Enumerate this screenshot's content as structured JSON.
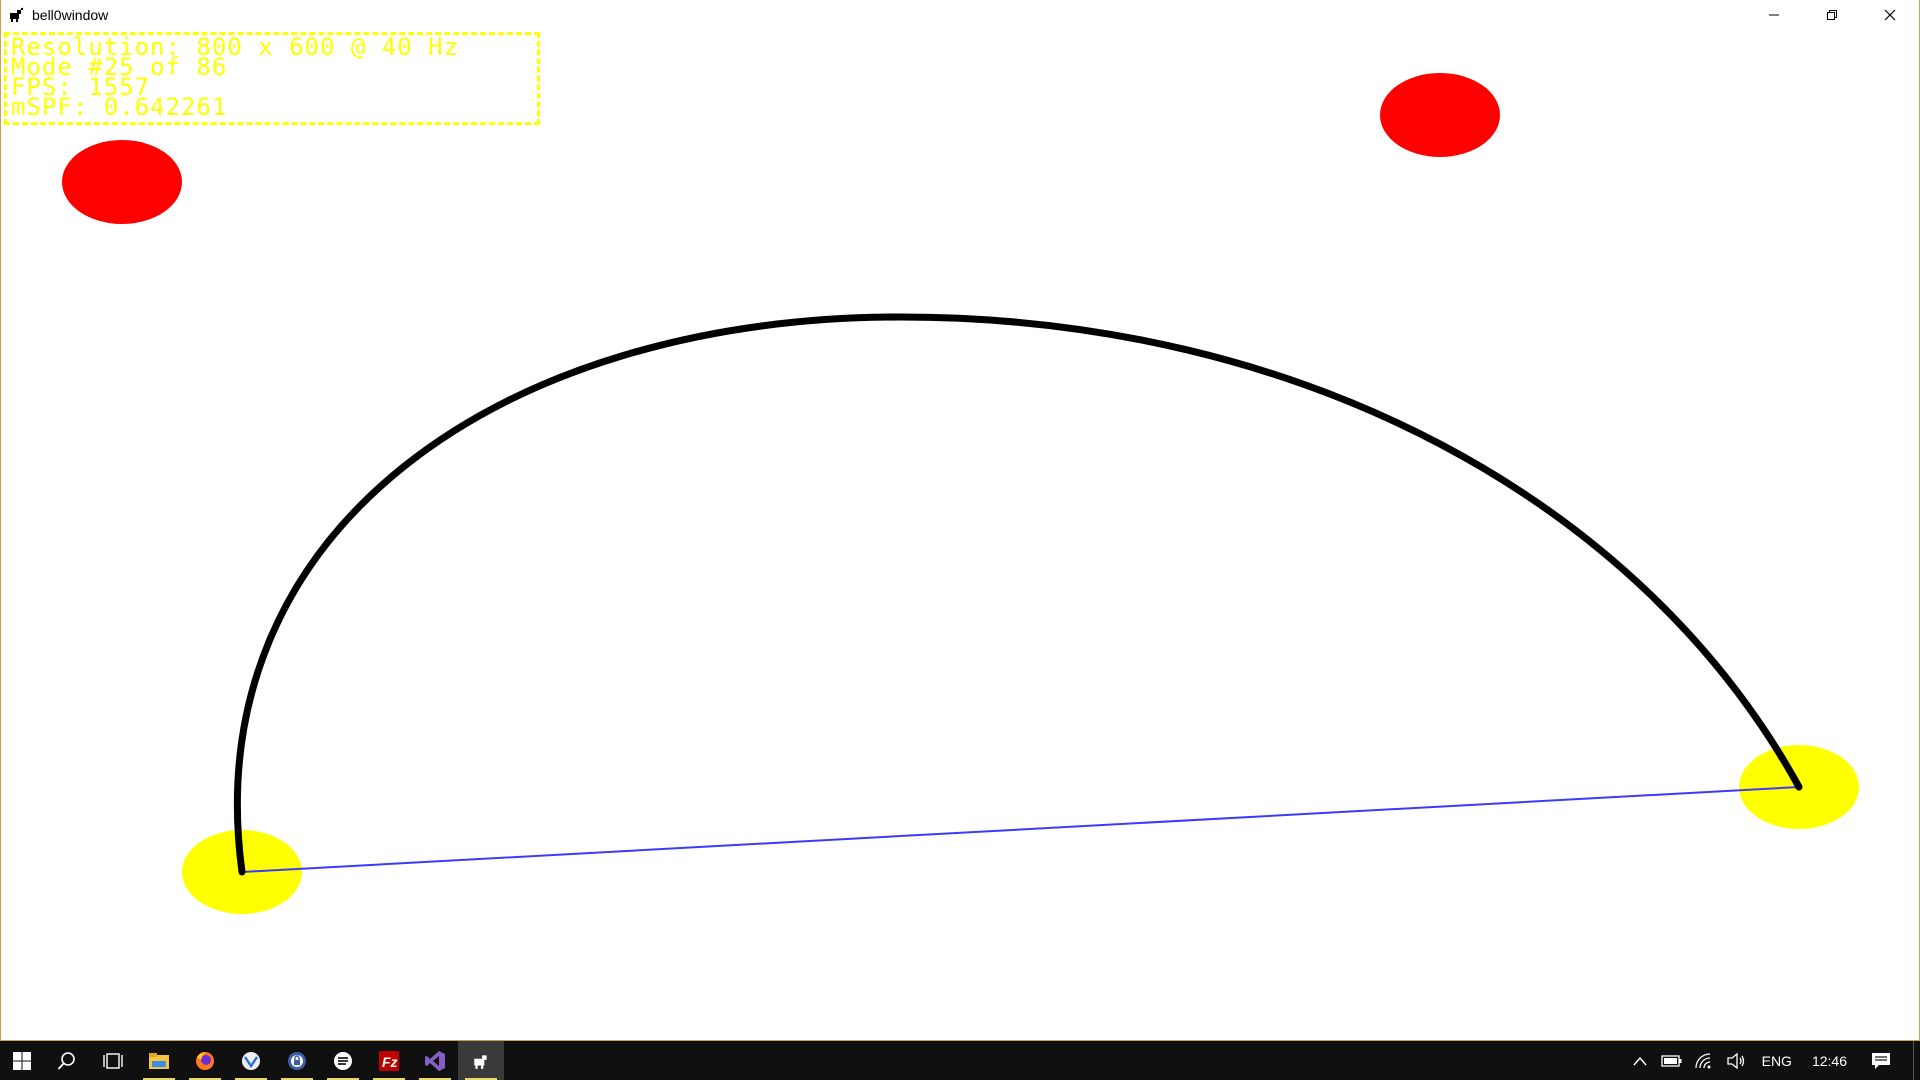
{
  "window": {
    "title": "bell0window"
  },
  "overlay": {
    "lines": [
      "Resolution: 800 x 600 @ 40 Hz",
      "Mode #25 of 86",
      "FPS: 1557",
      "mSPF: 0.642261"
    ],
    "color": "#ffff00"
  },
  "scene": {
    "background": "#ffffff",
    "obstacle_color": "#ff0000",
    "endpoint_color": "#ffff00",
    "curve_color": "#000000",
    "line_color": "#3b3bff"
  },
  "taskbar": {
    "pinned": [
      {
        "name": "file-explorer-icon",
        "active": false
      },
      {
        "name": "firefox-icon",
        "active": false
      },
      {
        "name": "vpn-icon",
        "active": false
      },
      {
        "name": "password-manager-icon",
        "active": false
      },
      {
        "name": "music-app-icon",
        "active": false
      },
      {
        "name": "filezilla-icon",
        "active": false
      },
      {
        "name": "visual-studio-icon",
        "active": false
      },
      {
        "name": "bell0window-app-icon",
        "active": true
      }
    ],
    "tray": {
      "language": "ENG",
      "time": "12:46"
    }
  }
}
